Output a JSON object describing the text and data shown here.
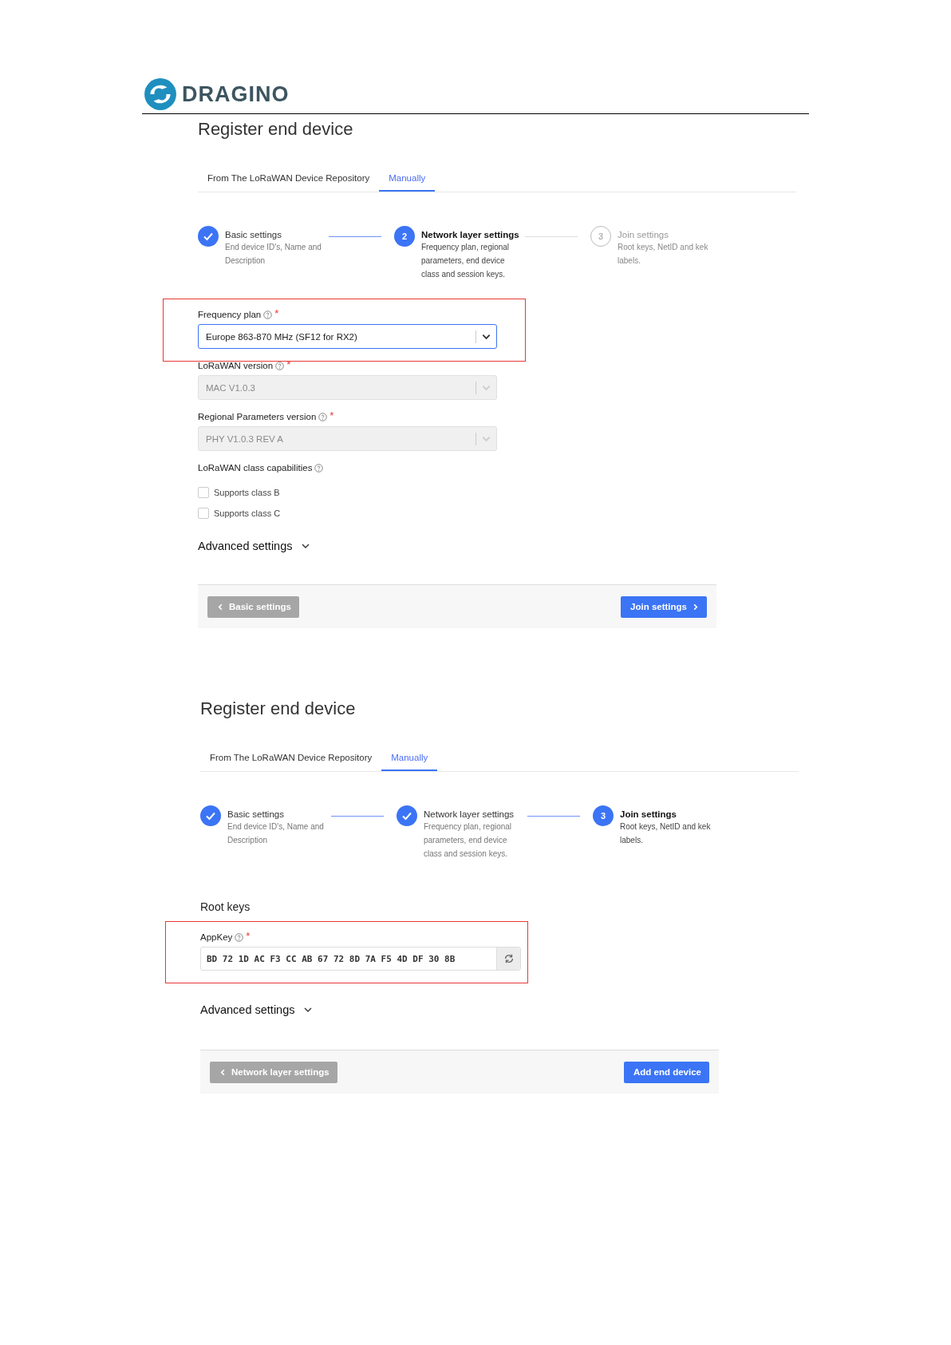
{
  "header": {
    "logo_text": "DRAGINO"
  },
  "panels": [
    {
      "title": "Register end device",
      "tabs": [
        {
          "label": "From The LoRaWAN Device Repository",
          "selected": false
        },
        {
          "label": "Manually",
          "selected": true
        }
      ],
      "steps": [
        {
          "done": true,
          "active": false,
          "title": "Basic settings",
          "description": "End device ID's, Name and Description"
        },
        {
          "done": false,
          "active": true,
          "number": "2",
          "title": "Network layer settings",
          "description": "Frequency plan, regional parameters, end device class and session keys."
        },
        {
          "done": false,
          "active": false,
          "number": "3",
          "title": "Join settings",
          "description": "Root keys, NetID and kek labels."
        }
      ],
      "fields": [
        {
          "kind": "select",
          "label": "Frequency plan",
          "help": true,
          "required_mark": "*",
          "value": "Europe 863-870 MHz (SF12 for RX2)",
          "disabled": false,
          "highlighted": true
        },
        {
          "kind": "select",
          "label": "LoRaWAN version",
          "help": true,
          "required_mark": "*",
          "value": "MAC V1.0.3",
          "disabled": true
        },
        {
          "kind": "select",
          "label": "Regional Parameters version",
          "help": true,
          "required_mark": "*",
          "value": "PHY V1.0.3 REV A",
          "disabled": true
        },
        {
          "kind": "group",
          "label": "LoRaWAN class capabilities",
          "help": true
        },
        {
          "kind": "checkbox",
          "label": "Supports class B",
          "checked": false
        },
        {
          "kind": "checkbox",
          "label": "Supports class C",
          "checked": false
        }
      ],
      "advanced": "Advanced settings",
      "back_button": "Basic settings",
      "next_button": {
        "label": "Join settings",
        "chevron": true
      }
    },
    {
      "title": "Register end device",
      "tabs": [
        {
          "label": "From The LoRaWAN Device Repository",
          "selected": false
        },
        {
          "label": "Manually",
          "selected": true
        }
      ],
      "steps": [
        {
          "done": true,
          "active": false,
          "title": "Basic settings",
          "description": "End device ID's, Name and Description"
        },
        {
          "done": true,
          "active": false,
          "title": "Network layer settings",
          "description": "Frequency plan, regional parameters, end device class and session keys."
        },
        {
          "done": false,
          "active": true,
          "number": "3",
          "title": "Join settings",
          "description": "Root keys, NetID and kek labels."
        }
      ],
      "fields": [
        {
          "kind": "heading",
          "label": "Root keys"
        },
        {
          "kind": "key",
          "label": "AppKey",
          "help": true,
          "required_mark": "*",
          "value": "BD 72 1D AC F3 CC AB 67 72 8D 7A F5 4D DF 30 8B",
          "highlighted": true
        }
      ],
      "advanced": "Advanced settings",
      "back_button": "Network layer settings",
      "next_button": {
        "label": "Add end device"
      }
    }
  ]
}
